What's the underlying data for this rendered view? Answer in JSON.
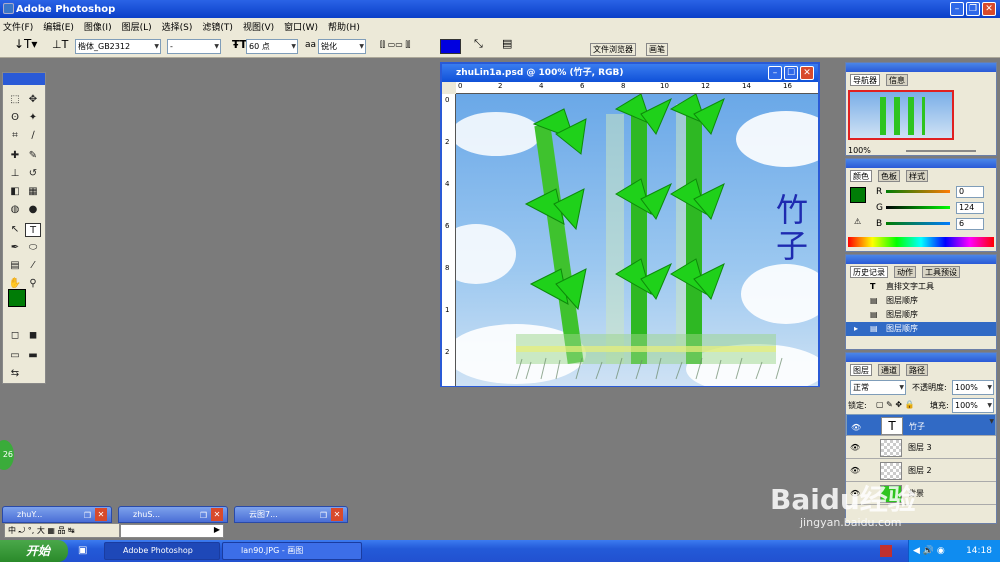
{
  "app": {
    "title": "Adobe Photoshop"
  },
  "menu": [
    "文件(F)",
    "编辑(E)",
    "图像(I)",
    "图层(L)",
    "选择(S)",
    "滤镜(T)",
    "视图(V)",
    "窗口(W)",
    "帮助(H)"
  ],
  "options": {
    "font_family": "楷体_GB2312",
    "font_style": "-",
    "font_size": "60 点",
    "aa_label": "aa",
    "antialias": "锐化",
    "text_color": "#0000e0",
    "palette_tab1": "文件浏览器",
    "palette_tab2": "画笔"
  },
  "document": {
    "title": "zhuLin1a.psd @ 100% (竹子, RGB)",
    "text": "竹子",
    "ruler_h": [
      "0",
      "2",
      "4",
      "6",
      "8",
      "10",
      "12",
      "14",
      "16"
    ],
    "ruler_v": [
      "0",
      "2",
      "4",
      "6",
      "8",
      "1",
      "2"
    ]
  },
  "navigator": {
    "tab1": "导航器",
    "tab2": "信息",
    "zoom": "100%"
  },
  "color": {
    "tab1": "颜色",
    "tab2": "色板",
    "tab3": "样式",
    "r_label": "R",
    "r": "0",
    "g_label": "G",
    "g": "124",
    "b_label": "B",
    "b": "6",
    "fg": "#007c06"
  },
  "history": {
    "tab1": "历史记录",
    "tab2": "动作",
    "tab3": "工具预设",
    "items": [
      "直排文字工具",
      "图层顺序",
      "图层顺序",
      "图层顺序"
    ]
  },
  "layers": {
    "tab1": "图层",
    "tab2": "通道",
    "tab3": "路径",
    "blend": "正常",
    "opacity_label": "不透明度:",
    "opacity": "100%",
    "lock_label": "锁定:",
    "fill_label": "填充:",
    "fill": "100%",
    "items": [
      "竹子",
      "图层 3",
      "图层 2",
      "背景"
    ]
  },
  "minimized": [
    "zhuY...",
    "zhuS...",
    "云图7..."
  ],
  "ime": "中 ⤾ °, 大 ▦ 品 ↹",
  "taskbar": {
    "start": "开始",
    "tasks": [
      "Adobe Photoshop",
      "lan90.JPG - 画图"
    ],
    "time": "14:18"
  },
  "watermark": {
    "brand": "Baidu经验",
    "url": "jingyan.baidu.com"
  },
  "badge": "26"
}
